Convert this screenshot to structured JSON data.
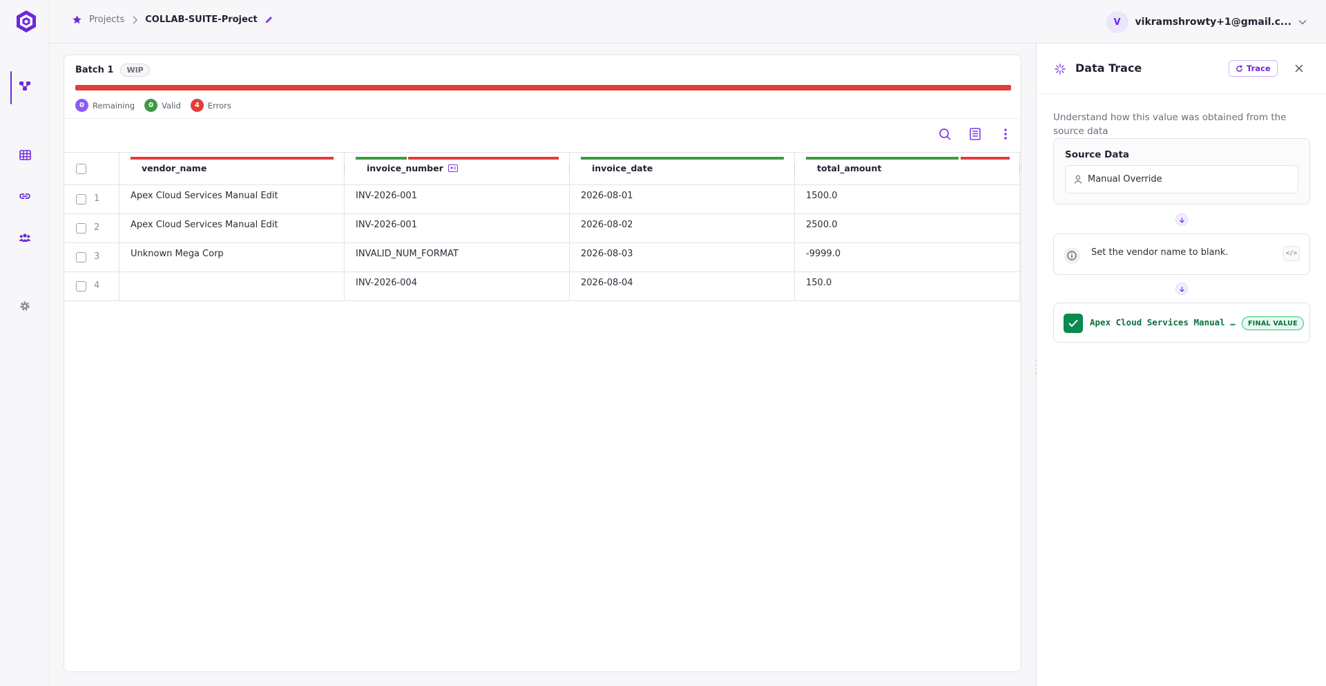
{
  "rail": {
    "items": [
      {
        "icon": "workflow-icon",
        "active": true
      },
      {
        "icon": "table-icon",
        "active": false
      },
      {
        "icon": "link-icon",
        "active": false
      },
      {
        "icon": "users-icon",
        "active": false
      },
      {
        "icon": "gear-icon",
        "active": false
      }
    ]
  },
  "topbar": {
    "breadcrumb_root": "Projects",
    "breadcrumb_current": "COLLAB-SUITE-Project",
    "user_initial": "V",
    "user_email": "vikramshrowty+1@gmail.c..."
  },
  "batch": {
    "title": "Batch 1",
    "status": "WIP",
    "remaining_count": "0",
    "remaining_label": "Remaining",
    "valid_count": "0",
    "valid_label": "Valid",
    "errors_count": "4",
    "errors_label": "Errors"
  },
  "grid": {
    "columns": [
      "vendor_name",
      "invoice_number",
      "invoice_date",
      "total_amount"
    ],
    "rows": [
      {
        "num": "1",
        "vendor_name": "Apex Cloud Services Manual Edit",
        "invoice_number": "INV-2026-001",
        "invoice_date": "2026-08-01",
        "total_amount": "1500.0"
      },
      {
        "num": "2",
        "vendor_name": "Apex Cloud Services Manual Edit",
        "invoice_number": "INV-2026-001",
        "invoice_date": "2026-08-02",
        "total_amount": "2500.0"
      },
      {
        "num": "3",
        "vendor_name": "Unknown Mega Corp",
        "invoice_number": "INVALID_NUM_FORMAT",
        "invoice_date": "2026-08-03",
        "total_amount": "-9999.0"
      },
      {
        "num": "4",
        "vendor_name": "",
        "invoice_number": "INV-2026-004",
        "invoice_date": "2026-08-04",
        "total_amount": "150.0"
      }
    ]
  },
  "panel": {
    "title": "Data Trace",
    "trace_button": "Trace",
    "description": "Understand how this value was obtained from the source data",
    "source_title": "Source Data",
    "source_value": "Manual Override",
    "step_text": "Set the vendor name to blank.",
    "code_label": "</>",
    "final_value": "Apex Cloud Services Manual Edit",
    "final_badge": "FINAL VALUE"
  },
  "colors": {
    "accent": "#6d28d9",
    "error": "#e23c3c",
    "valid": "#3e9a44",
    "remaining": "#8b5cf6",
    "final_green": "#0b8a4f"
  }
}
